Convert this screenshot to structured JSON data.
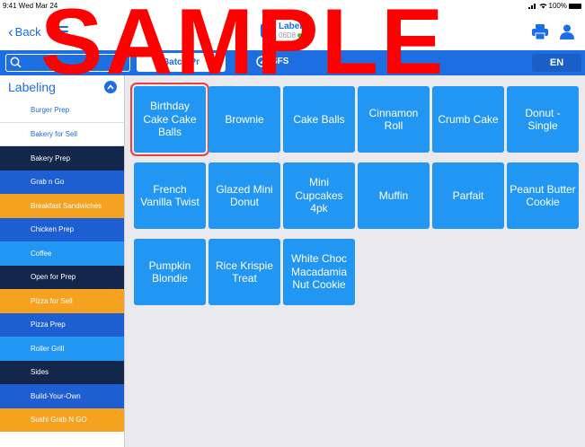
{
  "status_bar": {
    "time": "9:41 Wed Mar 24",
    "battery": "100%"
  },
  "header": {
    "back_label": "Back",
    "title": "Labeling",
    "subtitle": "06D8"
  },
  "toolbar": {
    "search_placeholder": "",
    "batch_label": "Batch Pr",
    "location_label": "SFS",
    "language": "EN"
  },
  "sidebar": {
    "title": "Labeling",
    "items": [
      {
        "label": "Burger Prep",
        "style": "white"
      },
      {
        "label": "Bakery for Sell",
        "style": "white"
      },
      {
        "label": "Bakery Prep",
        "style": "navy"
      },
      {
        "label": "Grab n Go",
        "style": "blue"
      },
      {
        "label": "Breakfast Sandwiches",
        "style": "orange"
      },
      {
        "label": "Chicken Prep",
        "style": "blue"
      },
      {
        "label": "Coffee",
        "style": "sky"
      },
      {
        "label": "Open for Prep",
        "style": "navy"
      },
      {
        "label": "Pizza for Sell",
        "style": "orange"
      },
      {
        "label": "Pizza Prep",
        "style": "blue"
      },
      {
        "label": "Roller Grill",
        "style": "sky"
      },
      {
        "label": "Sides",
        "style": "navy"
      },
      {
        "label": "Build-Your-Own",
        "style": "blue"
      },
      {
        "label": "Sushi Grab N GO",
        "style": "orange"
      }
    ]
  },
  "products": [
    {
      "label": "Birthday Cake Cake Balls",
      "selected": true
    },
    {
      "label": "Brownie"
    },
    {
      "label": "Cake Balls"
    },
    {
      "label": "Cinnamon Roll"
    },
    {
      "label": "Crumb Cake"
    },
    {
      "label": "Donut - Single"
    },
    {
      "label": "French Vanilla Twist"
    },
    {
      "label": "Glazed Mini Donut"
    },
    {
      "label": "Mini Cupcakes 4pk"
    },
    {
      "label": "Muffin"
    },
    {
      "label": "Parfait"
    },
    {
      "label": "Peanut Butter Cookie"
    },
    {
      "label": "Pumpkin Blondie"
    },
    {
      "label": "Rice Krispie Treat"
    },
    {
      "label": "White Choc Macadamia Nut Cookie"
    }
  ],
  "watermark": "SAMPLE",
  "colors": {
    "accent": "#1d6ee0",
    "tile": "#2196f3",
    "navy": "#13264b",
    "orange": "#f4a21f",
    "selection": "#e84040",
    "watermark": "#ff0000"
  }
}
